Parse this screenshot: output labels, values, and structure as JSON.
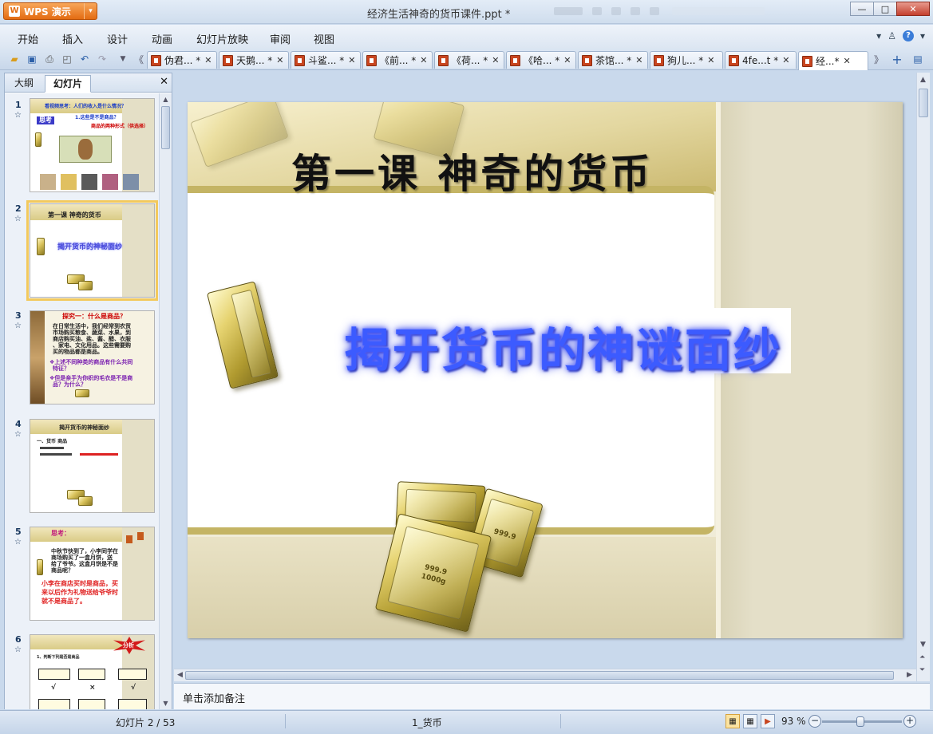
{
  "app": {
    "name": "WPS 演示",
    "document_title": "经济生活神奇的货币课件.ppt *"
  },
  "window_controls": {
    "minimize": "—",
    "maximize": "□",
    "close": "✕"
  },
  "menu": {
    "items": [
      "开始",
      "插入",
      "设计",
      "动画",
      "幻灯片放映",
      "审阅",
      "视图"
    ]
  },
  "doc_tabs": [
    {
      "label": "伪君... *"
    },
    {
      "label": "天鹅... *"
    },
    {
      "label": "斗鲨... *"
    },
    {
      "label": "《前... *"
    },
    {
      "label": "《荷... *"
    },
    {
      "label": "《哈... *"
    },
    {
      "label": "茶馆... *"
    },
    {
      "label": "狗儿... *"
    },
    {
      "label": "4fe...t *"
    },
    {
      "label": "经...*"
    }
  ],
  "panel": {
    "tabs": [
      "大纲",
      "幻灯片"
    ],
    "close": "✕"
  },
  "thumbnails": [
    {
      "num": "1",
      "texts": [
        "看视频思考：人们的收入是什么情况？",
        "思考",
        "1.这些是不是商品？",
        "商品的两种形式（供选择）"
      ]
    },
    {
      "num": "2",
      "texts": [
        "第一课   神奇的货币",
        "揭开货币的神秘面纱"
      ]
    },
    {
      "num": "3",
      "texts": [
        "探究一：什么是商品？",
        "在日常生活中，我们经常到农贸",
        "市场购买粮食、蔬菜、水果，到",
        "商店购买油、盐、酱、醋、衣服",
        "、家电、文化用品。这些需要购",
        "买的物品都是商品。",
        "❖上述不同种类的商品有什么共同",
        "特征？",
        "❖但是亲手为你织的毛衣是不是商",
        "品？为什么？"
      ]
    },
    {
      "num": "4",
      "texts": [
        "揭开货币的神秘面纱",
        "一、货币 商品"
      ]
    },
    {
      "num": "5",
      "texts": [
        "思考：",
        "中秋节快到了，小李同学在",
        "商场购买了一盒月饼，送",
        "给了爷爷。这盒月饼是不是",
        "商品呢？",
        "小李在商店买时是商品，买",
        "来以后作为礼物送给爷爷时",
        "就不是商品了。"
      ]
    },
    {
      "num": "6",
      "texts": [
        "分析",
        "1、判断下列是否是商品",
        "√",
        "×",
        "√"
      ]
    }
  ],
  "slide": {
    "title": "第一课    神奇的货币",
    "headline": "揭开货币的神谜面纱",
    "bar_labels": {
      "bar1": "999.9",
      "bar2": "1000g",
      "bar3": "999.9"
    }
  },
  "notes": {
    "placeholder": "单击添加备注"
  },
  "status": {
    "slide_counter": "幻灯片 2 / 53",
    "theme": "1_货币",
    "zoom": "93 %"
  }
}
